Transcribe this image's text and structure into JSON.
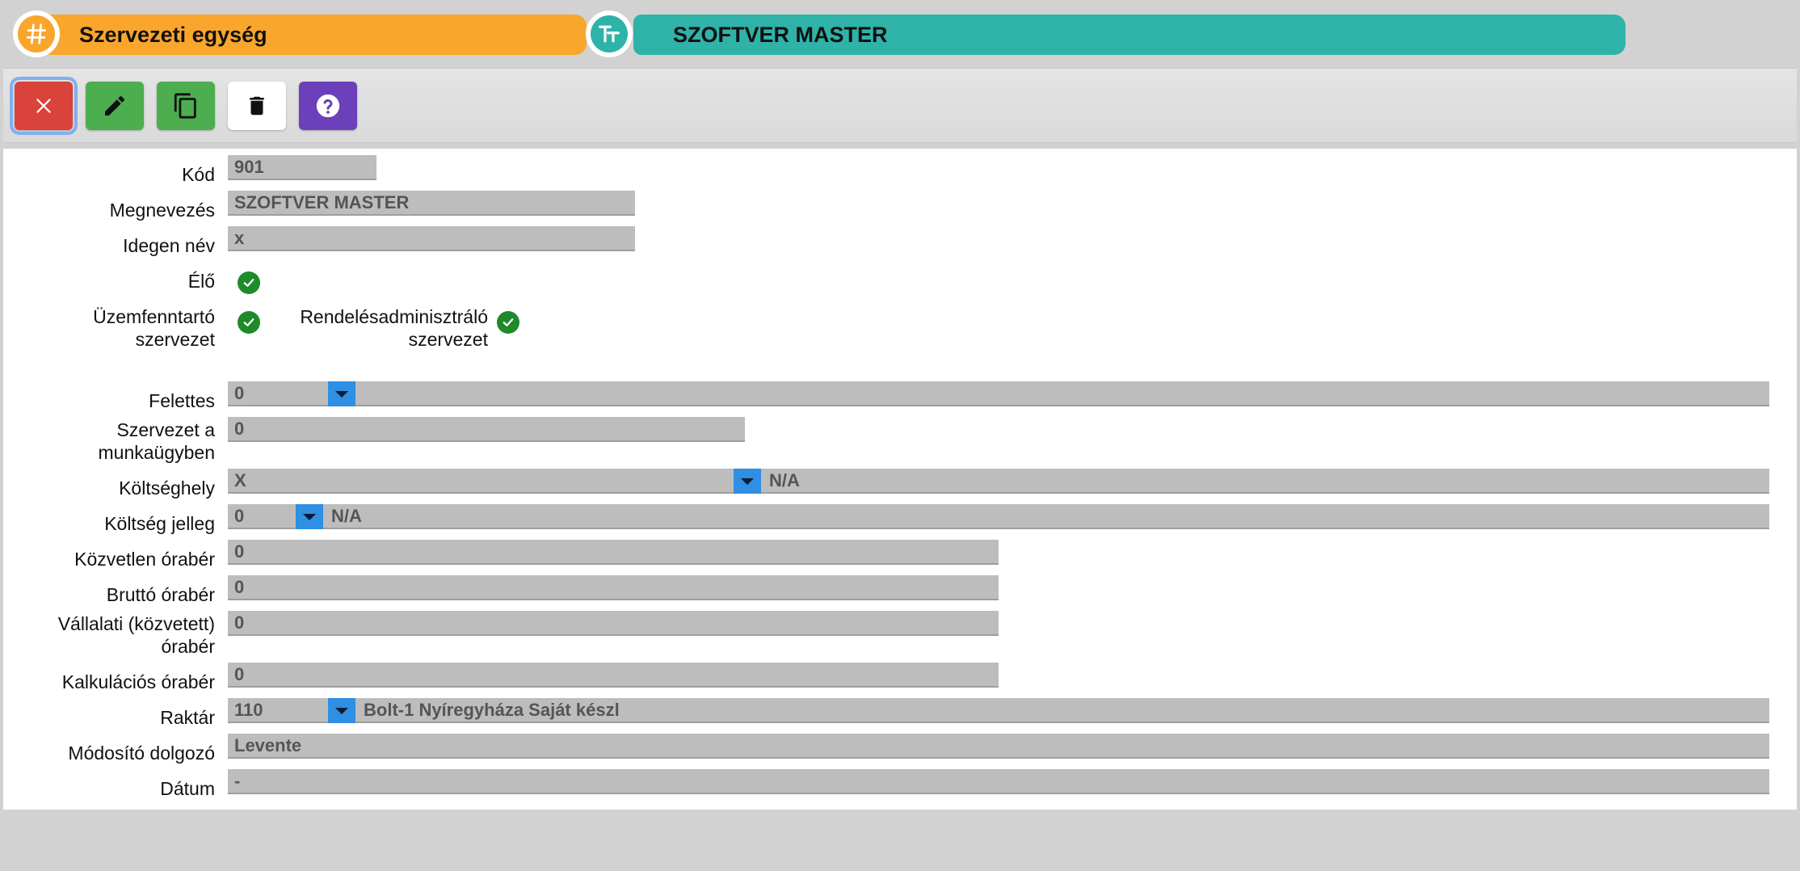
{
  "header": {
    "entity_icon": "hash-icon",
    "entity_label": "Szervezeti egység",
    "title_icon": "text-type-icon",
    "title_value": "SZOFTVER MASTER"
  },
  "toolbar": {
    "buttons": [
      {
        "name": "close",
        "icon": "close-icon",
        "color": "#d9433b"
      },
      {
        "name": "edit",
        "icon": "pencil-icon",
        "color": "#4cae4f"
      },
      {
        "name": "copy",
        "icon": "copy-icon",
        "color": "#4cae4f"
      },
      {
        "name": "delete",
        "icon": "trash-icon",
        "color": "#ffffff"
      },
      {
        "name": "help",
        "icon": "help-icon",
        "color": "#6c3fbb"
      }
    ]
  },
  "form": {
    "kod": {
      "label": "Kód",
      "value": "901"
    },
    "megnevezes": {
      "label": "Megnevezés",
      "value": "SZOFTVER MASTER"
    },
    "idegen_nev": {
      "label": "Idegen név",
      "value": "x"
    },
    "elo": {
      "label": "Élő",
      "checked": true
    },
    "uzemfenntarto": {
      "label_line1": "Üzemfenntartó",
      "label_line2": "szervezet",
      "checked": true
    },
    "rendeles": {
      "label_line1": "Rendelésadminisztráló",
      "label_line2": "szervezet",
      "checked": true
    },
    "felettes": {
      "label": "Felettes",
      "value": "0"
    },
    "munkaugy": {
      "label_line1": "Szervezet a",
      "label_line2": "munkaügyben",
      "value": "0"
    },
    "koltseghely": {
      "label": "Költséghely",
      "value": "X",
      "description": "N/A"
    },
    "koltseg_jelleg": {
      "label": "Költség jelleg",
      "value": "0",
      "description": "N/A"
    },
    "kozvetlen": {
      "label": "Közvetlen órabér",
      "value": "0"
    },
    "brutto": {
      "label": "Bruttó órabér",
      "value": "0"
    },
    "vallalati": {
      "label_line1": "Vállalati (közvetett)",
      "label_line2": "órabér",
      "value": "0"
    },
    "kalkulacios": {
      "label": "Kalkulációs órabér",
      "value": "0"
    },
    "raktar": {
      "label": "Raktár",
      "value": "110",
      "description": "Bolt-1 Nyíregyháza Saját készl"
    },
    "modosito": {
      "label": "Módosító dolgozó",
      "value": "Levente"
    },
    "datum": {
      "label": "Dátum",
      "value": "-"
    }
  }
}
